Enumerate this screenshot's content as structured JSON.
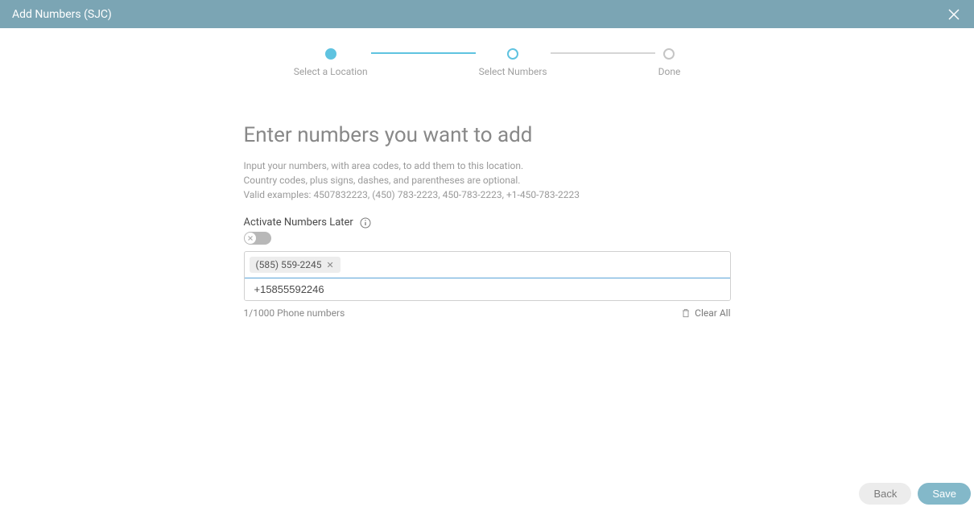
{
  "header": {
    "title": "Add Numbers (SJC)"
  },
  "stepper": {
    "steps": [
      {
        "label": "Select a Location"
      },
      {
        "label": "Select Numbers"
      },
      {
        "label": "Done"
      }
    ]
  },
  "main": {
    "heading": "Enter numbers you want to add",
    "description_line1": "Input your numbers, with area codes, to add them to this location.",
    "description_line2": "Country codes, plus signs, dashes, and parentheses are optional.",
    "description_line3": "Valid examples: 4507832223, (450) 783-2223, 450-783-2223, +1-450-783-2223",
    "toggle_label": "Activate Numbers Later",
    "chips": [
      {
        "text": "(585) 559-2245"
      }
    ],
    "input_value": "+15855592246",
    "counter": "1/1000 Phone numbers",
    "clear_all": "Clear All"
  },
  "footer": {
    "back": "Back",
    "save": "Save"
  }
}
